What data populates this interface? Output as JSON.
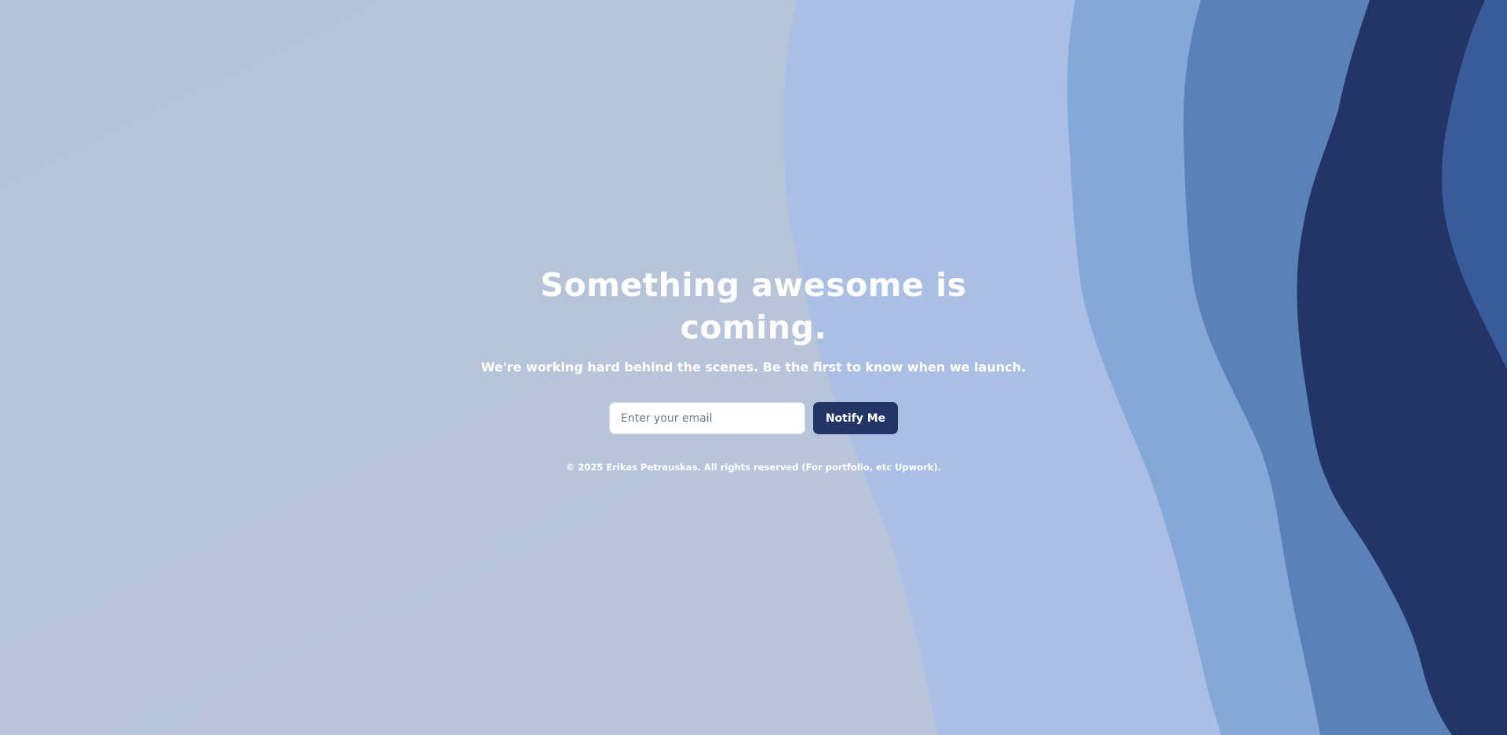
{
  "hero": {
    "headline_line1": "Something awesome is",
    "headline_line2": "coming.",
    "subtitle": "We're working hard behind the scenes. Be the first to know when we launch."
  },
  "signup": {
    "email_placeholder": "Enter your email",
    "email_value": "",
    "button_label": "Notify Me"
  },
  "footer": {
    "copyright": "© 2025 Erikas Petrauskas. All rights reserved (For portfolio, etc Upwork)."
  },
  "colors": {
    "background": "#b7c4da",
    "wave_light": "#aabfe3",
    "wave_mid": "#86a8d8",
    "wave_blue": "#5a81b8",
    "wave_dark": "#223566",
    "wave_edge": "#3a5b99",
    "button": "#223566",
    "text": "#ffffff"
  }
}
